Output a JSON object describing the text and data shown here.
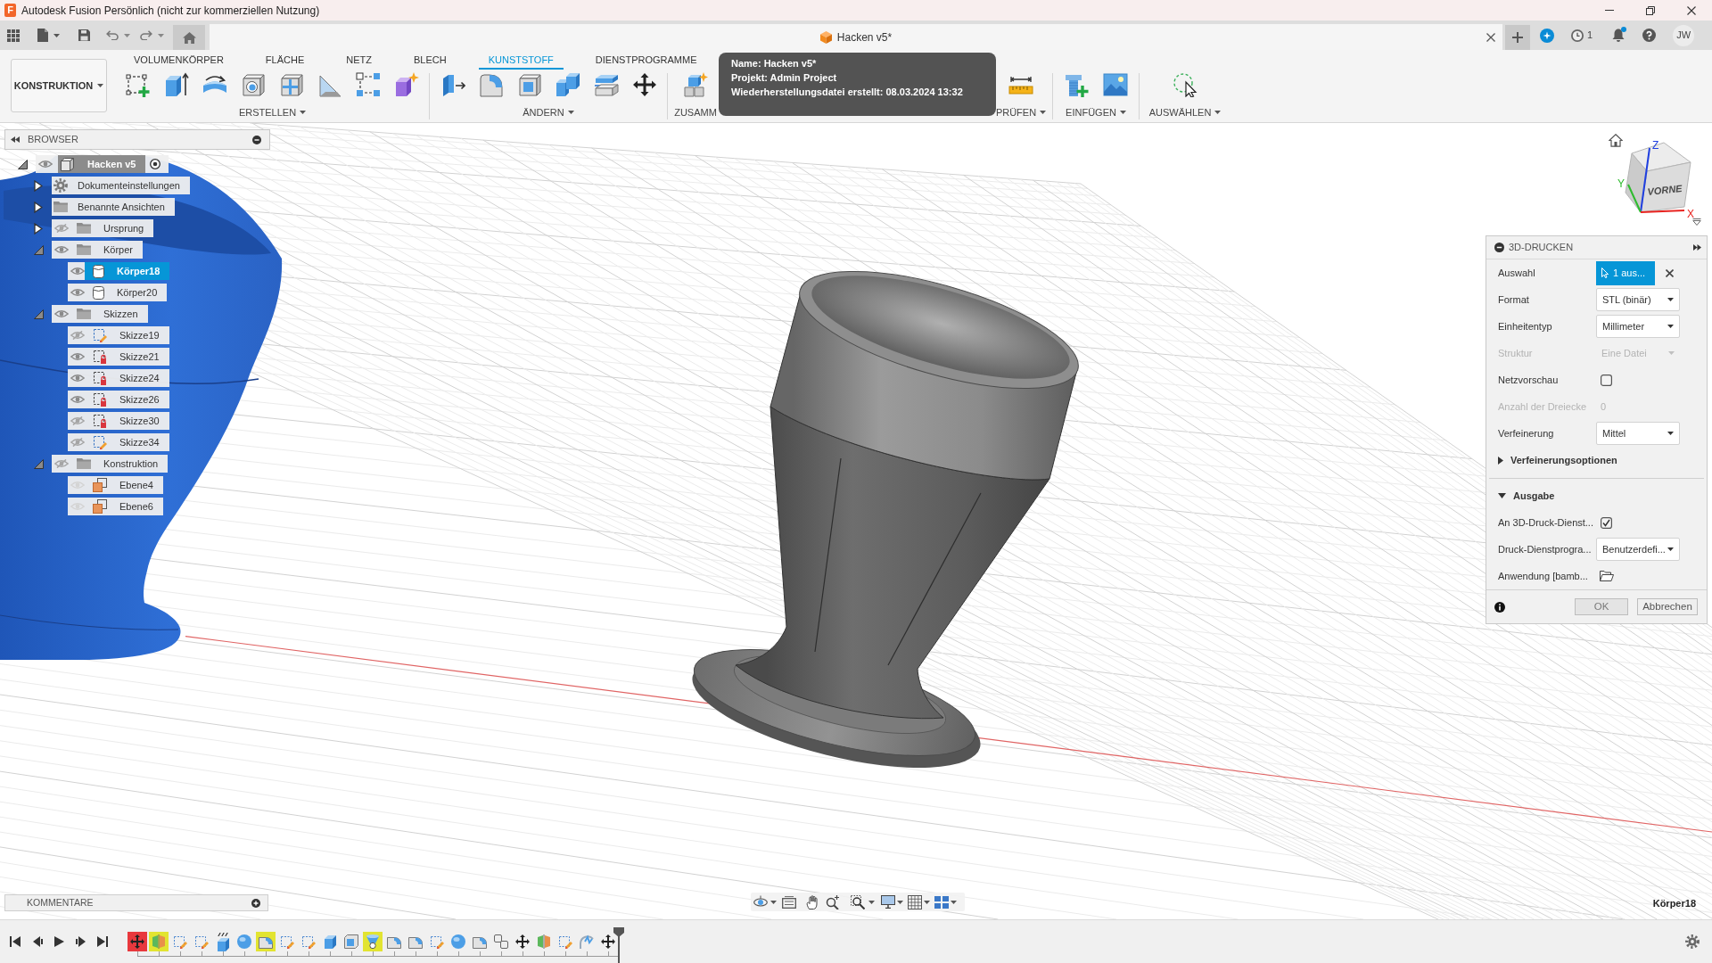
{
  "title_bar": {
    "logo_letter": "F",
    "title": "Autodesk Fusion Persönlich (nicht zur kommerziellen Nutzung)"
  },
  "document_tab": {
    "title": "Hacken v5*"
  },
  "header": {
    "jobs": "1",
    "notification": true,
    "avatar": "JW"
  },
  "workspace_menu": {
    "label": "KONSTRUKTION"
  },
  "ribbon_tabs": [
    {
      "label": "VOLUMENKÖRPER",
      "selected": false
    },
    {
      "label": "FLÄCHE",
      "selected": false
    },
    {
      "label": "NETZ",
      "selected": false
    },
    {
      "label": "BLECH",
      "selected": false
    },
    {
      "label": "KUNSTSTOFF",
      "selected": true
    },
    {
      "label": "DIENSTPROGRAMME",
      "selected": false
    }
  ],
  "tool_groups": [
    {
      "label": "ERSTELLEN",
      "dropdown": true
    },
    {
      "label": "ÄNDERN",
      "dropdown": true
    },
    {
      "label": "ZUSAMM",
      "dropdown": false
    },
    {
      "label": "PRÜFEN",
      "dropdown": true
    },
    {
      "label": "EINFÜGEN",
      "dropdown": true
    },
    {
      "label": "AUSWÄHLEN",
      "dropdown": true
    }
  ],
  "tooltip": {
    "lines": [
      "Name: Hacken v5*",
      "Projekt: Admin Project",
      "Wiederherstellungsdatei erstellt: 08.03.2024 13:32"
    ]
  },
  "browser": {
    "title": "BROWSER",
    "tree": [
      {
        "label": "Hacken v5",
        "kind": "component",
        "visible": true,
        "active": true,
        "expanded": true,
        "selected": false,
        "children": [
          {
            "label": "Dokumenteinstellungen",
            "kind": "settings",
            "expanded": false,
            "selected": false
          },
          {
            "label": "Benannte Ansichten",
            "kind": "folder",
            "expanded": false,
            "selected": false
          },
          {
            "label": "Ursprung",
            "kind": "folder",
            "visible": false,
            "expanded": false,
            "selected": false
          },
          {
            "label": "Körper",
            "kind": "folder",
            "visible": true,
            "expanded": true,
            "selected": false,
            "children": [
              {
                "label": "Körper18",
                "kind": "body",
                "visible": true,
                "selected": true
              },
              {
                "label": "Körper20",
                "kind": "body",
                "visible": true,
                "selected": false
              }
            ]
          },
          {
            "label": "Skizzen",
            "kind": "folder",
            "visible": true,
            "expanded": true,
            "selected": false,
            "children": [
              {
                "label": "Skizze19",
                "kind": "sketch",
                "visible": false,
                "locked": false,
                "selected": false
              },
              {
                "label": "Skizze21",
                "kind": "sketch",
                "visible": true,
                "locked": true,
                "selected": false
              },
              {
                "label": "Skizze24",
                "kind": "sketch",
                "visible": true,
                "locked": true,
                "selected": false
              },
              {
                "label": "Skizze26",
                "kind": "sketch",
                "visible": true,
                "locked": true,
                "selected": false
              },
              {
                "label": "Skizze30",
                "kind": "sketch",
                "visible": false,
                "locked": true,
                "selected": false
              },
              {
                "label": "Skizze34",
                "kind": "sketch",
                "visible": false,
                "locked": false,
                "selected": false
              }
            ]
          },
          {
            "label": "Konstruktion",
            "kind": "folder",
            "visible": false,
            "expanded": true,
            "selected": false,
            "children": [
              {
                "label": "Ebene4",
                "kind": "plane",
                "visible": true,
                "selected": false
              },
              {
                "label": "Ebene6",
                "kind": "plane",
                "visible": true,
                "selected": false
              }
            ]
          }
        ]
      }
    ]
  },
  "viewcube": {
    "face_label": "VORNE",
    "axes": [
      {
        "label": "Z",
        "color": "#1f3fe0"
      },
      {
        "label": "Y",
        "color": "#2dbb2d"
      },
      {
        "label": "X",
        "color": "#e8231f"
      }
    ]
  },
  "print_panel": {
    "title": "3D-DRUCKEN",
    "fields": [
      {
        "kind": "selection",
        "label": "Auswahl",
        "value": "1 aus..."
      },
      {
        "kind": "dropdown",
        "label": "Format",
        "value": "STL (binär)",
        "disabled": false
      },
      {
        "kind": "dropdown",
        "label": "Einheitentyp",
        "value": "Millimeter",
        "disabled": false
      },
      {
        "kind": "dropdown",
        "label": "Struktur",
        "value": "Eine Datei",
        "disabled": true
      },
      {
        "kind": "checkbox",
        "label": "Netzvorschau",
        "checked": false
      },
      {
        "kind": "readout",
        "label": "Anzahl der Dreiecke",
        "value": "0",
        "disabled": true
      },
      {
        "kind": "dropdown",
        "label": "Verfeinerung",
        "value": "Mittel",
        "disabled": false
      },
      {
        "kind": "section",
        "label": "Verfeinerungsoptionen",
        "expanded": false
      },
      {
        "kind": "section",
        "label": "Ausgabe",
        "expanded": true
      },
      {
        "kind": "checkbox",
        "label": "An 3D-Druck-Dienst...",
        "checked": true
      },
      {
        "kind": "dropdown",
        "label": "Druck-Dienstprogra...",
        "value": "Benutzerdefi...",
        "disabled": false
      },
      {
        "kind": "file",
        "label": "Anwendung [bamb..."
      }
    ],
    "buttons": [
      "OK",
      "Abbrechen"
    ]
  },
  "comments": {
    "title": "KOMMENTARE"
  },
  "status_bar": {
    "selection": "Körper18"
  },
  "timeline": {
    "items": [
      {
        "kind": "move",
        "color": "#e8383d",
        "flag": false
      },
      {
        "kind": "split",
        "color": "#e2e431",
        "flag": false
      },
      {
        "kind": "sketch",
        "flag": false
      },
      {
        "kind": "sketch",
        "flag": false
      },
      {
        "kind": "extrude",
        "flag": true
      },
      {
        "kind": "sphere",
        "flag": false
      },
      {
        "kind": "fillet",
        "color": "#e2e431",
        "flag": false
      },
      {
        "kind": "sketch",
        "flag": false
      },
      {
        "kind": "sketch",
        "flag": false
      },
      {
        "kind": "extrude",
        "flag": false
      },
      {
        "kind": "shell",
        "flag": false
      },
      {
        "kind": "loft",
        "color": "#e2e431",
        "flag": false
      },
      {
        "kind": "fillet",
        "flag": false
      },
      {
        "kind": "fillet",
        "flag": false
      },
      {
        "kind": "sketch",
        "flag": false
      },
      {
        "kind": "sphere",
        "flag": false
      },
      {
        "kind": "fillet",
        "flag": false
      },
      {
        "kind": "joint",
        "flag": false
      },
      {
        "kind": "move",
        "flag": false
      },
      {
        "kind": "split",
        "flag": false
      },
      {
        "kind": "sketch",
        "flag": false
      },
      {
        "kind": "emboss",
        "flag": false
      },
      {
        "kind": "move",
        "flag": false
      }
    ]
  }
}
